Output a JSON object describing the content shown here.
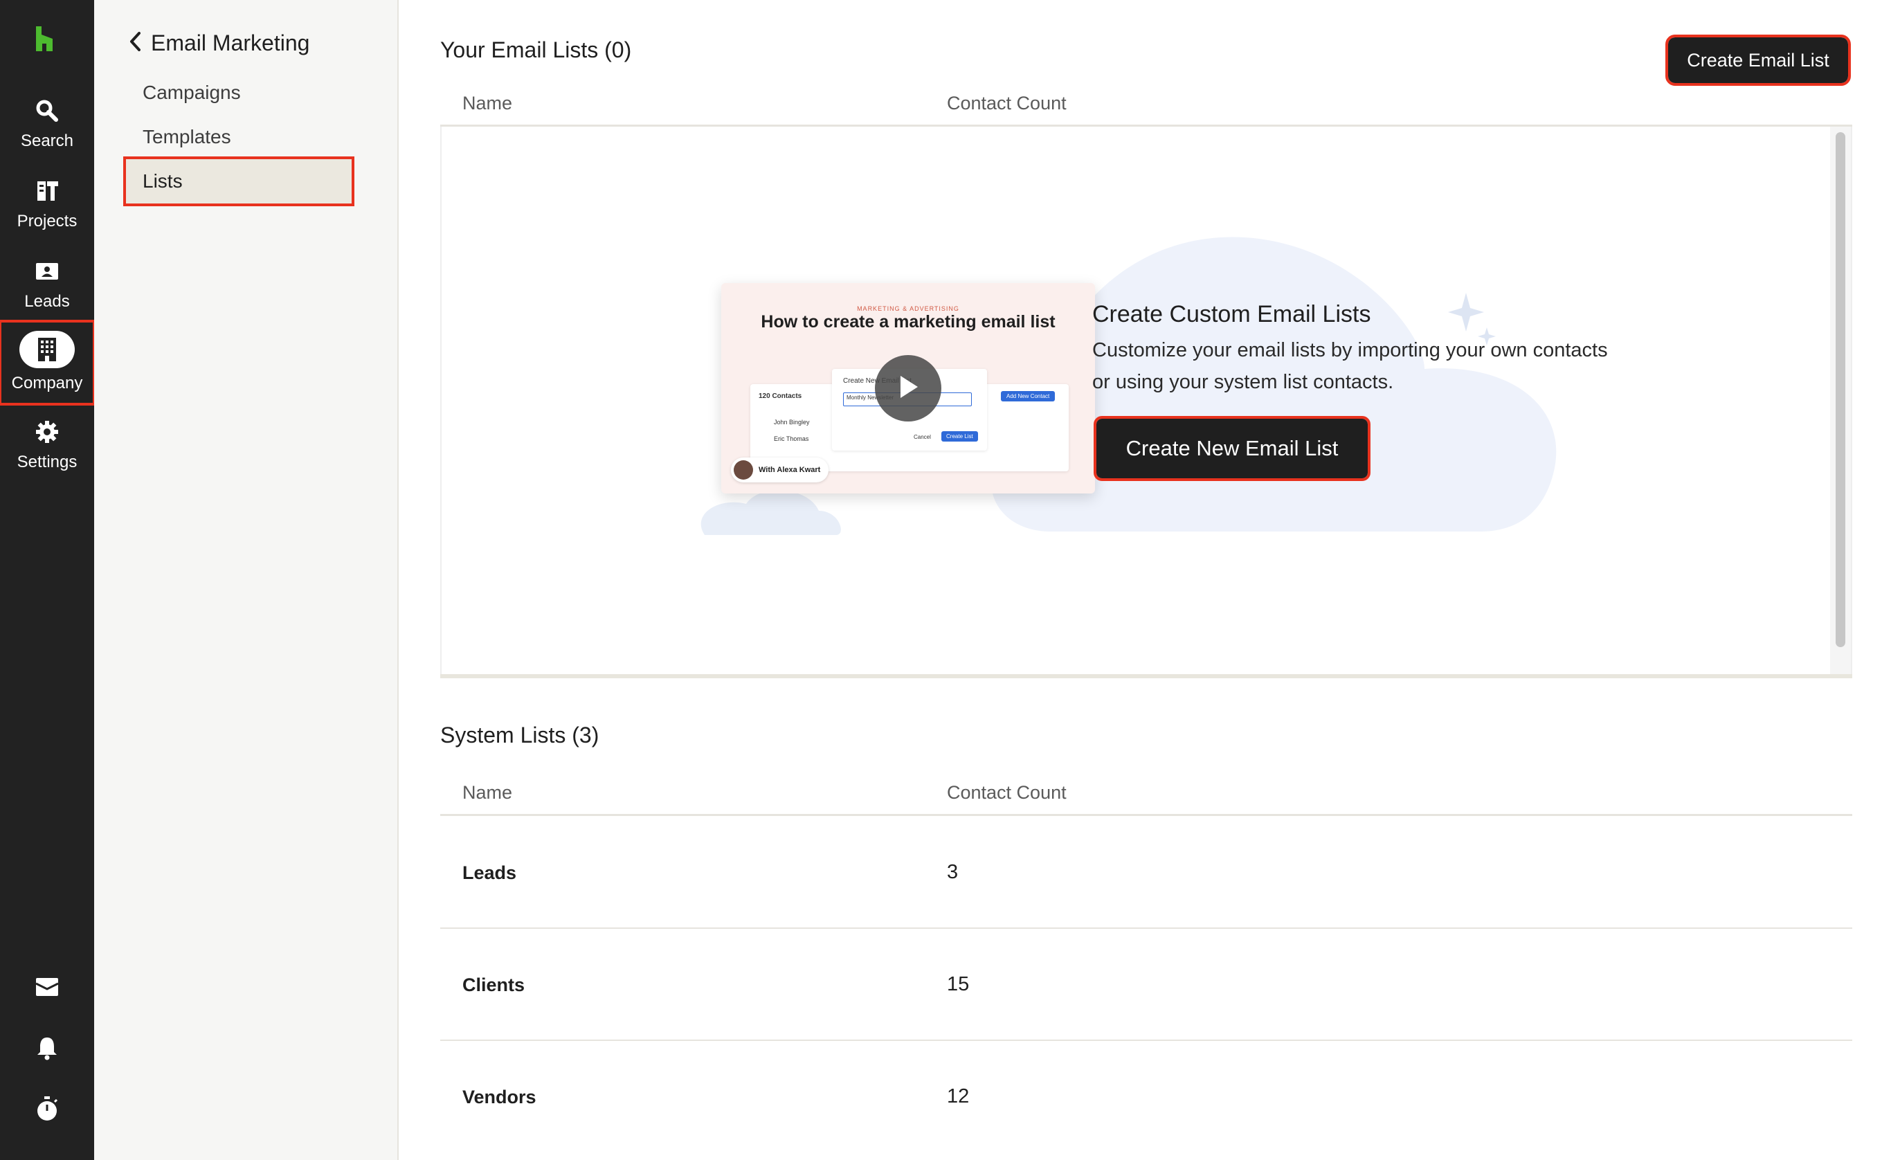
{
  "rail": {
    "items": [
      {
        "label": "Search"
      },
      {
        "label": "Projects"
      },
      {
        "label": "Leads"
      },
      {
        "label": "Company"
      },
      {
        "label": "Settings"
      }
    ]
  },
  "subnav": {
    "back_label": "Email Marketing",
    "links": [
      {
        "label": "Campaigns"
      },
      {
        "label": "Templates"
      },
      {
        "label": "Lists"
      }
    ]
  },
  "email_lists": {
    "title": "Your Email Lists (0)",
    "create_button": "Create Email List",
    "columns": [
      "Name",
      "Contact Count"
    ]
  },
  "empty_state": {
    "video": {
      "eyebrow": "MARKETING & ADVERTISING",
      "title": "How to create a marketing email list",
      "mock_contacts": "120 Contacts",
      "mock_dialog_title": "Create New Email List",
      "mock_field": "Monthly Newsletter",
      "mock_cancel": "Cancel",
      "mock_create": "Create List",
      "mock_add": "Add New Contact",
      "mock_rows": [
        "John Bingley",
        "Eric Thomas"
      ],
      "presenter": "With Alexa Kwart"
    },
    "title": "Create Custom Email Lists",
    "description": "Customize your email lists by importing your own contacts or using your system list contacts.",
    "button": "Create New Email List"
  },
  "system_lists": {
    "title": "System Lists (3)",
    "columns": [
      "Name",
      "Contact Count"
    ],
    "rows": [
      {
        "name": "Leads",
        "count": "3"
      },
      {
        "name": "Clients",
        "count": "15"
      },
      {
        "name": "Vendors",
        "count": "12"
      }
    ]
  },
  "colors": {
    "rail_bg": "#222222",
    "brand_green": "#4dbb2f",
    "highlight_red": "#e8321e",
    "button_dark": "#1f1f1f"
  }
}
